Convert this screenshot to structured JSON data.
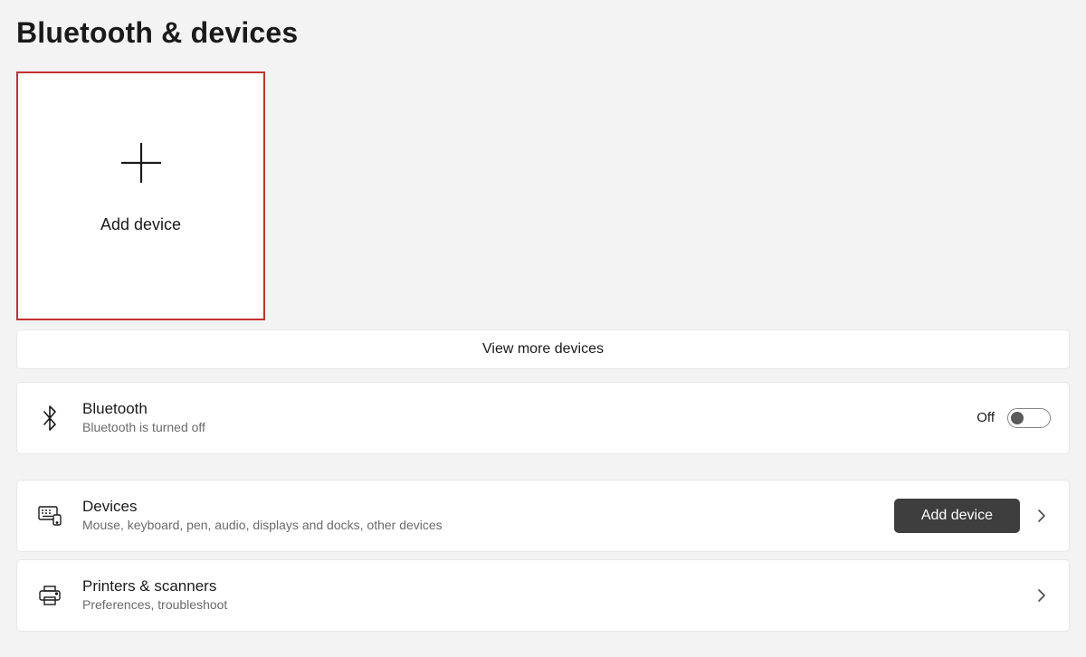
{
  "page": {
    "title": "Bluetooth & devices"
  },
  "add_tile": {
    "label": "Add device"
  },
  "view_more": {
    "label": "View more devices"
  },
  "bluetooth": {
    "title": "Bluetooth",
    "subtitle": "Bluetooth is turned off",
    "state_label": "Off"
  },
  "devices": {
    "title": "Devices",
    "subtitle": "Mouse, keyboard, pen, audio, displays and docks, other devices",
    "button_label": "Add device"
  },
  "printers": {
    "title": "Printers & scanners",
    "subtitle": "Preferences, troubleshoot"
  }
}
